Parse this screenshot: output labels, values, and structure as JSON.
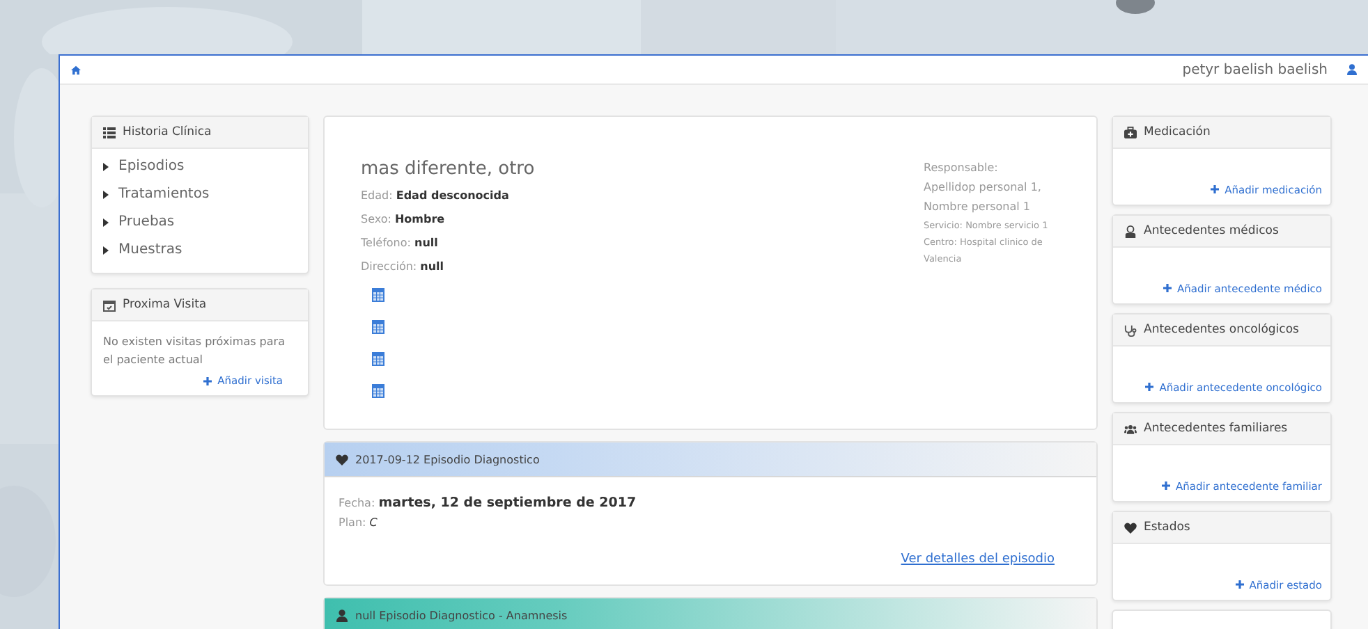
{
  "topbar": {
    "user": "petyr baelish baelish"
  },
  "left_panels": [
    {
      "kind": "list",
      "title": "Historia Clínica",
      "items": [
        "Episodios",
        "Tratamientos",
        "Pruebas",
        "Muestras"
      ]
    },
    {
      "kind": "visit",
      "title": "Proxima Visita",
      "text": "No existen visitas próximas para el paciente actual",
      "action": "Añadir visita"
    }
  ],
  "patient": {
    "name": "mas diferente, otro",
    "fields": [
      {
        "label": "Edad:",
        "value": "Edad desconocida"
      },
      {
        "label": "Sexo:",
        "value": "Hombre"
      },
      {
        "label": "Teléfono:",
        "value": "null"
      },
      {
        "label": "Dirección:",
        "value": "null"
      }
    ],
    "responsible": {
      "label": "Responsable:",
      "name": "Apellidop personal 1, Nombre personal 1",
      "service": "Servicio: Nombre servicio 1",
      "center": "Centro: Hospital clinico de Valencia"
    }
  },
  "episodes": [
    {
      "kind": "diagnostic",
      "title": "2017-09-12 Episodio Diagnostico",
      "color": "#b7d0f0",
      "expanded": true,
      "date_label": "Fecha:",
      "date": "martes, 12 de septiembre de 2017",
      "plan_label": "Plan:",
      "plan": "C",
      "link": "Ver detalles del episodio"
    },
    {
      "kind": "anamnesis",
      "title": "null Episodio Diagnostico - Anamnesis",
      "color": "#3fbfae",
      "expanded": false
    }
  ],
  "right_panels": [
    {
      "kind": "medication",
      "title": "Medicación",
      "action": "Añadir medicación"
    },
    {
      "kind": "medical",
      "title": "Antecedentes médicos",
      "action": "Añadir antecedente médico"
    },
    {
      "kind": "oncological",
      "title": "Antecedentes oncológicos",
      "action": "Añadir antecedente oncológico"
    },
    {
      "kind": "family",
      "title": "Antecedentes familiares",
      "action": "Añadir antecedente familiar"
    },
    {
      "kind": "states",
      "title": "Estados",
      "action": "Añadir estado"
    }
  ]
}
